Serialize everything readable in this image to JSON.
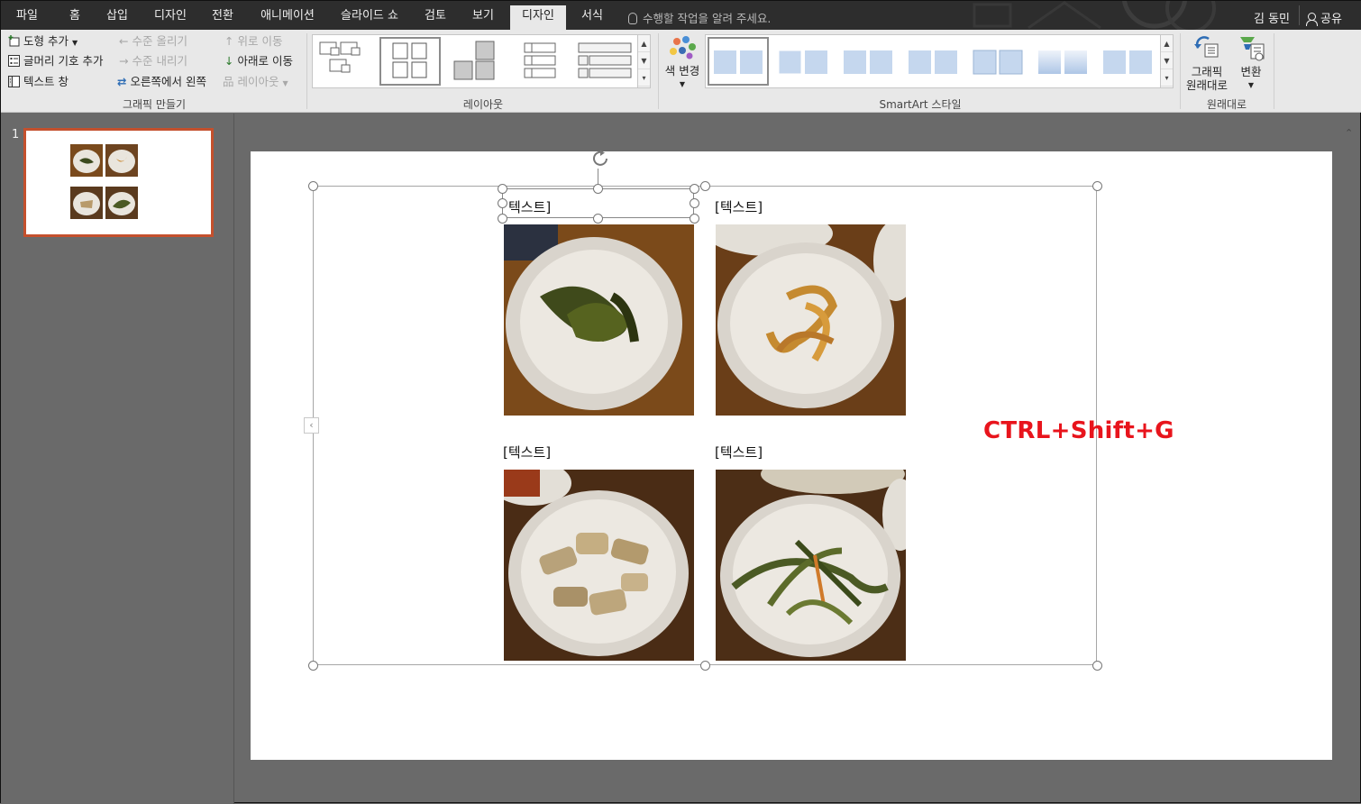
{
  "tabs": [
    {
      "label": "파일"
    },
    {
      "label": "홈"
    },
    {
      "label": "삽입"
    },
    {
      "label": "디자인"
    },
    {
      "label": "전환"
    },
    {
      "label": "애니메이션"
    },
    {
      "label": "슬라이드 쇼"
    },
    {
      "label": "검토"
    },
    {
      "label": "보기"
    },
    {
      "label": "디자인",
      "active": true
    },
    {
      "label": "서식"
    }
  ],
  "tellme_placeholder": "수행할 작업을 알려 주세요.",
  "user_name": "김 동민",
  "share_label": "공유",
  "ribbon": {
    "create_graphic": {
      "add_shape": "도형 추가",
      "add_bullet": "글머리 기호 추가",
      "text_pane": "텍스트 창",
      "promote": "수준 올리기",
      "demote": "수준 내리기",
      "right_to_left": "오른쪽에서 왼쪽",
      "move_up": "위로 이동",
      "move_down": "아래로 이동",
      "layout": "레이아웃",
      "group_label": "그래픽 만들기"
    },
    "layouts_label": "레이아웃",
    "change_colors": "색 변경",
    "styles_label": "SmartArt 스타일",
    "reset_graphic_line1": "그래픽",
    "reset_graphic_line2": "원래대로",
    "convert": "변환",
    "reset_group_label": "원래대로"
  },
  "thumbnail": {
    "slide_number": "1"
  },
  "slide": {
    "labels": [
      "[텍스트]",
      "[텍스트]",
      "[텍스트]",
      "[텍스트]"
    ],
    "first_label_partial": "텍스트]",
    "shortcut_text": "CTRL+Shift+G"
  },
  "colors": {
    "accent_red": "#e8141c",
    "thumb_border": "#c4502d",
    "tab_bar": "#2d2d2d",
    "ribbon_bg": "#e8e8e8"
  }
}
